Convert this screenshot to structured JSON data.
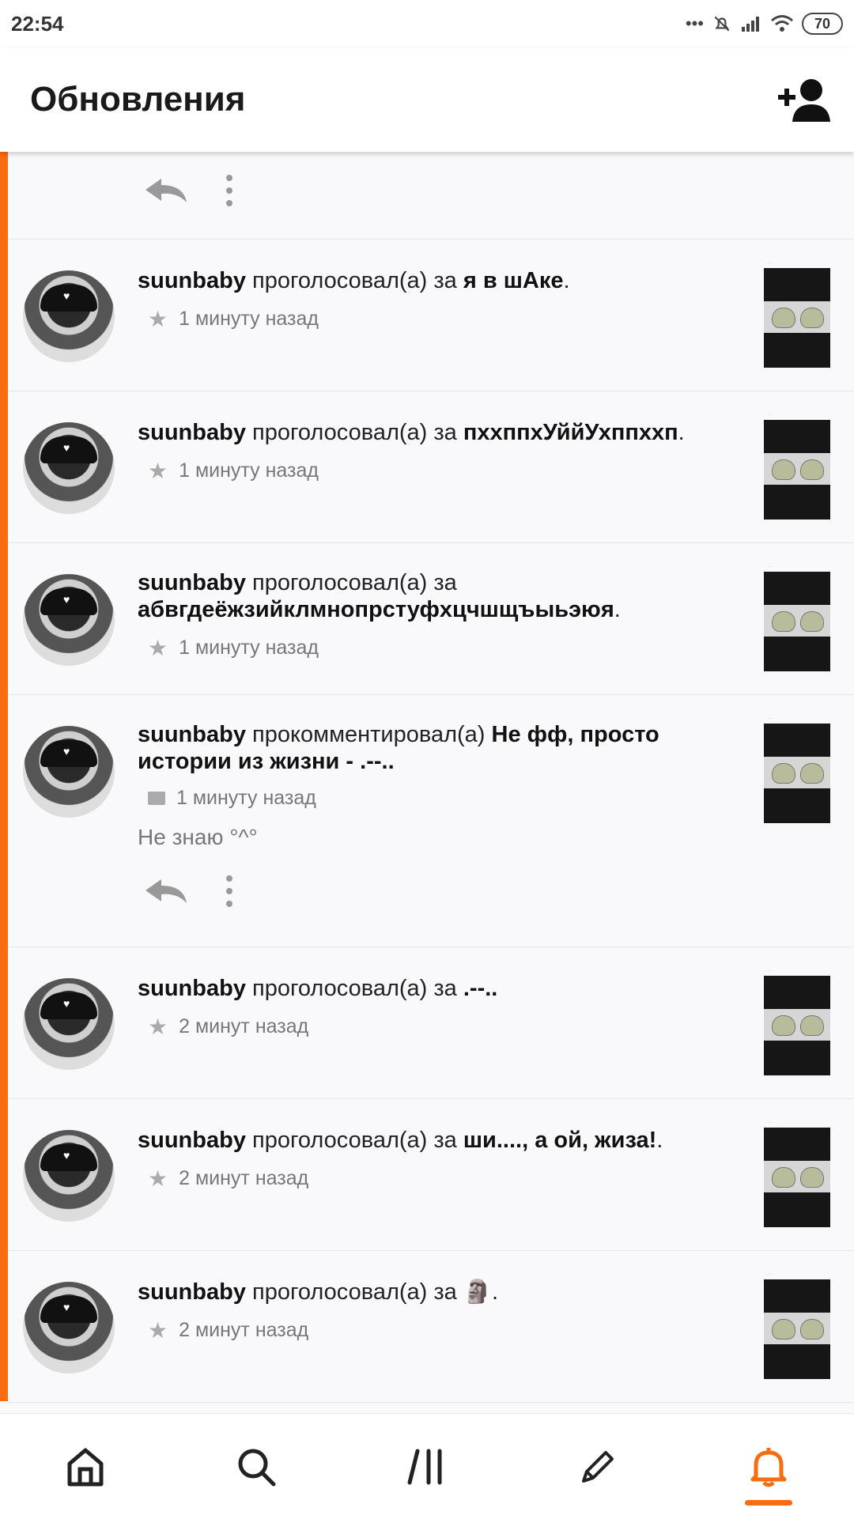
{
  "status_bar": {
    "time": "22:54",
    "battery": "70"
  },
  "header": {
    "title": "Обновления",
    "add_friend_icon": "add-user-icon"
  },
  "colors": {
    "accent": "#fa6c11"
  },
  "feed": {
    "top_actions": {
      "reply_icon": "reply-icon",
      "more_icon": "more-vertical-icon"
    },
    "items": [
      {
        "user": "suunbaby",
        "action": " проголосовал(а) за ",
        "target": "я в шАке",
        "suffix": ".",
        "time": "1 минуту назад",
        "type": "vote"
      },
      {
        "user": "suunbaby",
        "action": " проголосовал(а) за ",
        "target": "пххппхУййУхппххп",
        "suffix": ".",
        "time": "1 минуту назад",
        "type": "vote"
      },
      {
        "user": "suunbaby",
        "action": " проголосовал(а) за ",
        "target": "абвгдеёжзийклмнопрстуфхцчшщъыьэюя",
        "suffix": ".",
        "time": "1 минуту назад",
        "type": "vote"
      },
      {
        "user": "suunbaby",
        "action": " прокомментировал(а) ",
        "target": "Не фф, просто истории из жизни - .--..",
        "suffix": "",
        "time": "1 минуту назад",
        "type": "comment",
        "comment": "Не знаю °^°"
      },
      {
        "user": "suunbaby",
        "action": " проголосовал(а) за ",
        "target": ".--..",
        "suffix": "",
        "time": "2 минут назад",
        "type": "vote"
      },
      {
        "user": "suunbaby",
        "action": " проголосовал(а) за ",
        "target": "ши...., а ой, жиза!",
        "suffix": ".",
        "time": "2 минут назад",
        "type": "vote"
      },
      {
        "user": "suunbaby",
        "action": " проголосовал(а) за ",
        "target": "🗿",
        "suffix": ".",
        "time": "2 минут назад",
        "type": "vote"
      }
    ]
  },
  "nav": {
    "home": "home-icon",
    "search": "search-icon",
    "library": "library-icon",
    "write": "pencil-icon",
    "notifications": "bell-icon"
  }
}
